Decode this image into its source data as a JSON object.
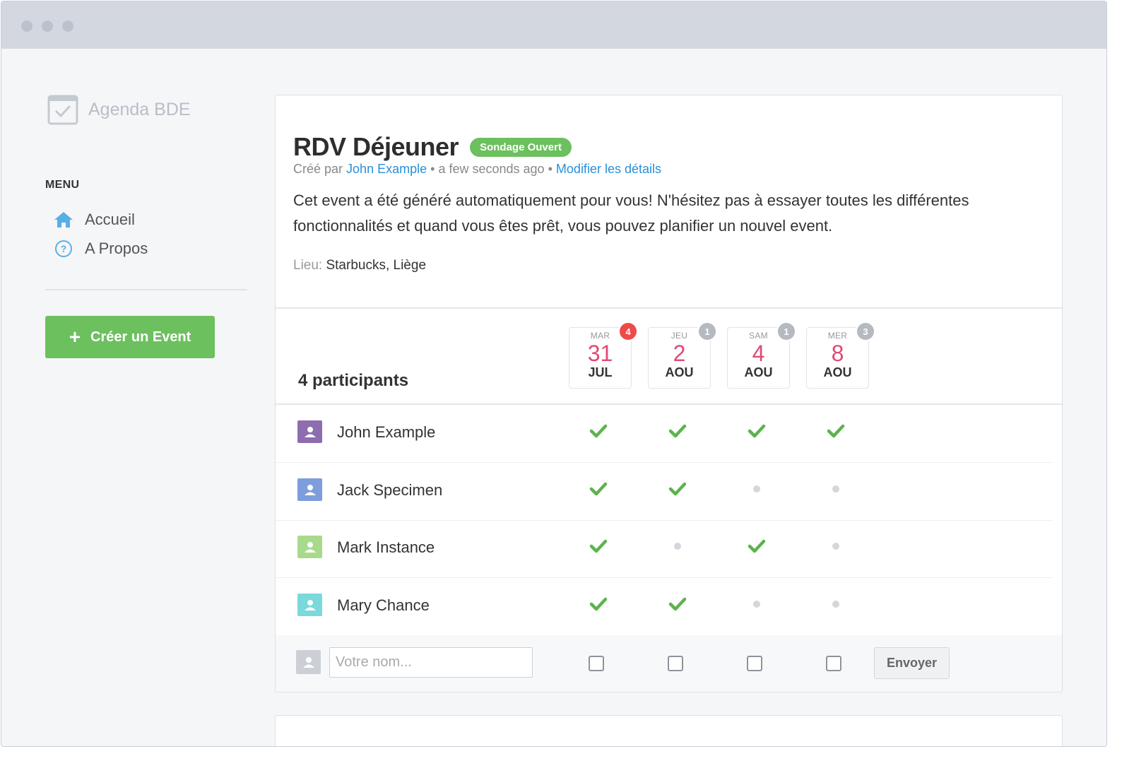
{
  "app": {
    "name": "Agenda BDE"
  },
  "sidebar": {
    "menu_title": "MENU",
    "items": [
      {
        "label": "Accueil",
        "icon": "home-icon"
      },
      {
        "label": "A Propos",
        "icon": "help-icon"
      }
    ],
    "create_button": "Créer un Event"
  },
  "event": {
    "title": "RDV Déjeuner",
    "status_badge": "Sondage Ouvert",
    "created_by_prefix": "Créé par",
    "author": "John Example",
    "time_ago": "a few seconds ago",
    "edit_link": "Modifier les détails",
    "description": "Cet event a été généré automatiquement pour vous! N'hésitez pas à essayer toutes les différentes fonctionnalités et quand vous êtes prêt, vous pouvez planifier un nouvel event.",
    "location_label": "Lieu:",
    "location": "Starbucks, Liège"
  },
  "poll": {
    "participants_label": "4 participants",
    "dates": [
      {
        "dow": "MAR",
        "day": "31",
        "month": "JUL",
        "count": "4",
        "highlight": true
      },
      {
        "dow": "JEU",
        "day": "2",
        "month": "AOU",
        "count": "1",
        "highlight": false
      },
      {
        "dow": "SAM",
        "day": "4",
        "month": "AOU",
        "count": "1",
        "highlight": false
      },
      {
        "dow": "MER",
        "day": "8",
        "month": "AOU",
        "count": "3",
        "highlight": false
      }
    ],
    "participants": [
      {
        "name": "John Example",
        "avatar_color": "#8e6cb0",
        "votes": [
          true,
          true,
          true,
          true
        ]
      },
      {
        "name": "Jack Specimen",
        "avatar_color": "#7d9ddc",
        "votes": [
          true,
          true,
          false,
          false
        ]
      },
      {
        "name": "Mark Instance",
        "avatar_color": "#a8da8c",
        "votes": [
          true,
          false,
          true,
          false
        ]
      },
      {
        "name": "Mary Chance",
        "avatar_color": "#79d9dc",
        "votes": [
          true,
          true,
          false,
          false
        ]
      }
    ],
    "name_placeholder": "Votre nom...",
    "send_button": "Envoyer"
  },
  "colors": {
    "accent_green": "#6cc05e",
    "link_blue": "#2a8fd8",
    "date_pink": "#e04a74",
    "badge_red": "#ef4a4a"
  }
}
